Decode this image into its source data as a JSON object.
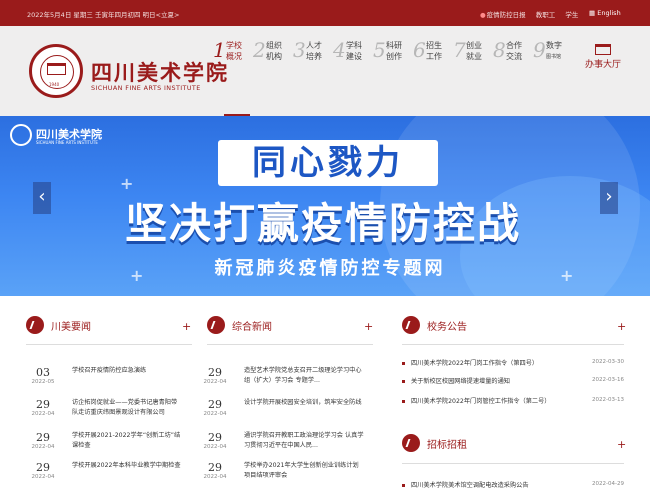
{
  "topbar": {
    "date": "2022年5月4日  星期三  壬寅年四月初四  明日<立夏>",
    "links": [
      "疫情防控日报",
      "教职工",
      "学生"
    ],
    "lang": "English"
  },
  "header": {
    "logo_cn": "四川美术学院",
    "logo_en": "SICHUAN FINE ARTS INSTITUTE",
    "logo_year": "1940",
    "nav": [
      {
        "num": "1",
        "l1": "学校",
        "l2": "概况"
      },
      {
        "num": "2",
        "l1": "组织",
        "l2": "机构"
      },
      {
        "num": "3",
        "l1": "人才",
        "l2": "培养"
      },
      {
        "num": "4",
        "l1": "学科",
        "l2": "建设"
      },
      {
        "num": "5",
        "l1": "科研",
        "l2": "创作"
      },
      {
        "num": "6",
        "l1": "招生",
        "l2": "工作"
      },
      {
        "num": "7",
        "l1": "创业",
        "l2": "就业"
      },
      {
        "num": "8",
        "l1": "合作",
        "l2": "交流"
      },
      {
        "num": "9",
        "l1": "数字",
        "l2": "图书馆"
      }
    ],
    "hall": "办事大厅"
  },
  "banner": {
    "logo_cn": "四川美术学院",
    "logo_en": "SICHUAN FINE ARTS INSTITUTE",
    "line1": "同心戮力",
    "line2": "坚决打赢疫情防控战",
    "line3": "新冠肺炎疫情防控专题网",
    "prev": "‹",
    "next": "›"
  },
  "sections": {
    "chuanmei": {
      "title": "川美要闻",
      "plus": "+",
      "items": [
        {
          "day": "03",
          "ym": "2022-05",
          "text": "学校召开疫情防控应急演练"
        },
        {
          "day": "29",
          "ym": "2022-04",
          "text": "访企拓岗促就业——党委书记唐青阳带队走访重庆纬图景观设计有限公司"
        },
        {
          "day": "29",
          "ym": "2022-04",
          "text": "学校开展2021-2022学年“创新工坊”结课检查"
        },
        {
          "day": "29",
          "ym": "2022-04",
          "text": "学校开展2022年本科毕业教学中期检查"
        }
      ]
    },
    "zonghe": {
      "title": "综合新闻",
      "plus": "+",
      "items": [
        {
          "day": "29",
          "ym": "2022-04",
          "text": "造型艺术学院党总支召开二级理论学习中心组（扩大）学习会 专题学..."
        },
        {
          "day": "29",
          "ym": "2022-04",
          "text": "设计学院开展校园安全培训，筑牢安全防线"
        },
        {
          "day": "29",
          "ym": "2022-04",
          "text": "通识学院召开教职工政治理论学习会 认真学习贯彻习近平在中国人民..."
        },
        {
          "day": "29",
          "ym": "2022-04",
          "text": "学校举办2021年大学生创新创业训练计划项目结项评审会"
        }
      ]
    },
    "notices": {
      "title": "校务公告",
      "plus": "+",
      "items": [
        {
          "text": "四川美术学院2022年门岗工作指令（第四号）",
          "date": "2022-03-30"
        },
        {
          "text": "关于新校区校园网络提速增量的通知",
          "date": "2022-03-16"
        },
        {
          "text": "四川美术学院2022年门岗管控工作指令（第二号）",
          "date": "2022-03-13"
        }
      ]
    },
    "bidding": {
      "title": "招标招租",
      "plus": "+",
      "items": [
        {
          "text": "四川美术学院美术馆空调配电改造采购公告",
          "date": "2022-04-29"
        }
      ]
    }
  }
}
